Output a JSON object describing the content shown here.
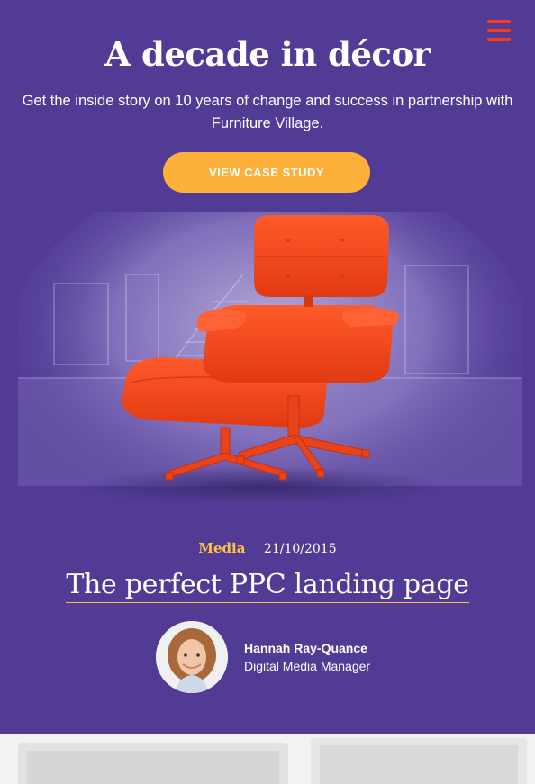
{
  "hero": {
    "title": "A decade in décor",
    "subtitle": "Get the inside story on 10 years of change and success in partnership with Furniture Village.",
    "cta_label": "VIEW CASE STUDY",
    "menu_icon": "hamburger-icon"
  },
  "post": {
    "category": "Media",
    "date": "21/10/2015",
    "title": "The perfect PPC landing page",
    "author": {
      "name": "Hannah Ray-Quance",
      "role": "Digital Media Manager"
    }
  },
  "colors": {
    "hero_bg": "#513b95",
    "accent_orange": "#f03c1a",
    "cta_yellow": "#fdb03a",
    "category_yellow": "#fdc244"
  }
}
